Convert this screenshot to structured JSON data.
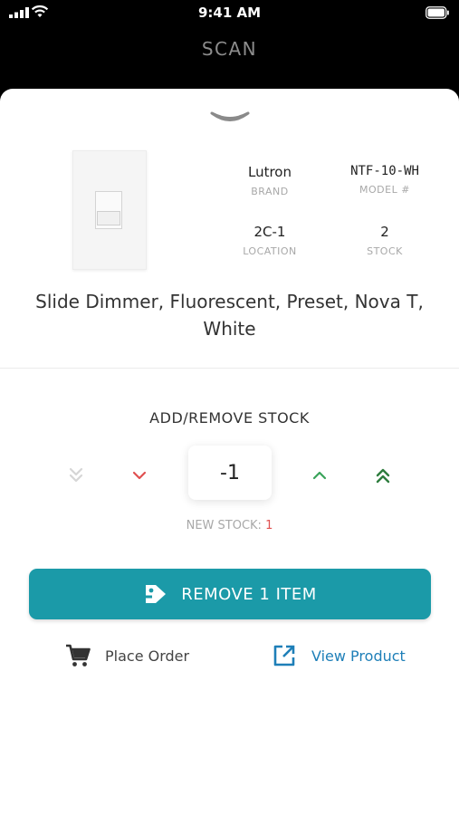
{
  "status_bar": {
    "time": "9:41 AM"
  },
  "header": {
    "title": "SCAN"
  },
  "product": {
    "brand": "Lutron",
    "brand_label": "BRAND",
    "model": "NTF-10-WH",
    "model_label": "MODEL #",
    "location": "2C-1",
    "location_label": "LOCATION",
    "stock": "2",
    "stock_label": "STOCK",
    "name": "Slide Dimmer, Fluorescent, Preset, Nova T, White"
  },
  "adjust": {
    "title": "ADD/REMOVE STOCK",
    "quantity": "-1",
    "new_stock_label": "NEW STOCK:",
    "new_stock_value": "1"
  },
  "actions": {
    "primary_label": "REMOVE 1 ITEM",
    "place_order_label": "Place Order",
    "view_product_label": "View Product"
  },
  "colors": {
    "accent": "#1b9aa8",
    "decrease": "#e05050",
    "increase": "#3aa35a",
    "link": "#1e7fb8"
  },
  "icons": {
    "decrease_fast": "double-chevron-down-icon",
    "decrease": "chevron-down-icon",
    "increase": "chevron-up-icon",
    "increase_fast": "double-chevron-up-icon",
    "primary": "tag-icon",
    "place_order": "cart-icon",
    "view_product": "external-link-icon"
  }
}
